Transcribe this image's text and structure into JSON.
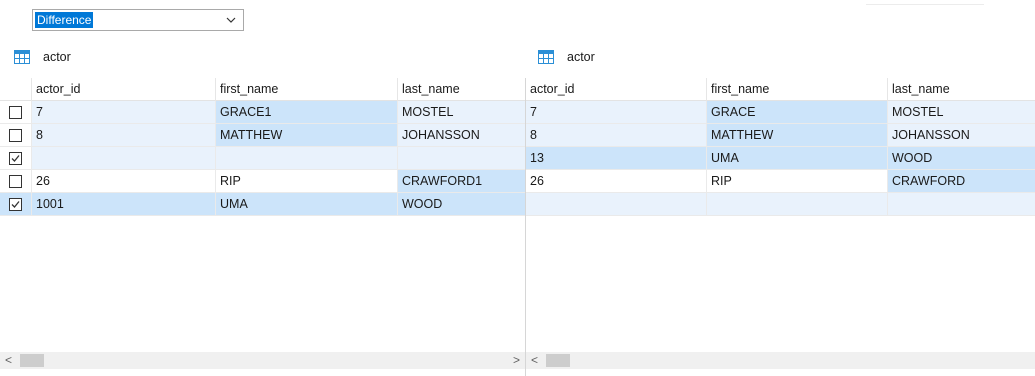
{
  "filter": {
    "selected": "Difference"
  },
  "left_panel": {
    "table_name": "actor",
    "columns": [
      "actor_id",
      "first_name",
      "last_name"
    ],
    "rows": [
      {
        "checked": false,
        "cells": [
          "7",
          "GRACE1",
          "MOSTEL"
        ],
        "cell_states": [
          "light",
          "strong",
          "light"
        ]
      },
      {
        "checked": false,
        "cells": [
          "8",
          "MATTHEW",
          "JOHANSSON"
        ],
        "cell_states": [
          "light",
          "strong",
          "light"
        ]
      },
      {
        "checked": true,
        "cells": [
          "",
          "",
          ""
        ],
        "cell_states": [
          "light",
          "light",
          "light"
        ]
      },
      {
        "checked": false,
        "cells": [
          "26",
          "RIP",
          "CRAWFORD1"
        ],
        "cell_states": [
          "plain",
          "plain",
          "strong"
        ]
      },
      {
        "checked": true,
        "cells": [
          "1001",
          "UMA",
          "WOOD"
        ],
        "cell_states": [
          "row",
          "row",
          "row"
        ]
      }
    ]
  },
  "right_panel": {
    "table_name": "actor",
    "columns": [
      "actor_id",
      "first_name",
      "last_name"
    ],
    "rows": [
      {
        "cells": [
          "7",
          "GRACE",
          "MOSTEL"
        ],
        "cell_states": [
          "light",
          "strong",
          "light"
        ]
      },
      {
        "cells": [
          "8",
          "MATTHEW",
          "JOHANSSON"
        ],
        "cell_states": [
          "light",
          "strong",
          "light"
        ]
      },
      {
        "cells": [
          "13",
          "UMA",
          "WOOD"
        ],
        "cell_states": [
          "row",
          "row",
          "row"
        ]
      },
      {
        "cells": [
          "26",
          "RIP",
          "CRAWFORD"
        ],
        "cell_states": [
          "plain",
          "plain",
          "strong"
        ]
      },
      {
        "cells": [
          "",
          "",
          ""
        ],
        "cell_states": [
          "light",
          "light",
          "light"
        ]
      }
    ]
  },
  "scrollbar": {
    "left_arrow": "<",
    "right_arrow": ">"
  },
  "colors": {
    "selection": "#0078d7",
    "diff_strong": "#cce4fa",
    "diff_light": "#e9f2fc",
    "table_icon": "#2b8fd6"
  }
}
